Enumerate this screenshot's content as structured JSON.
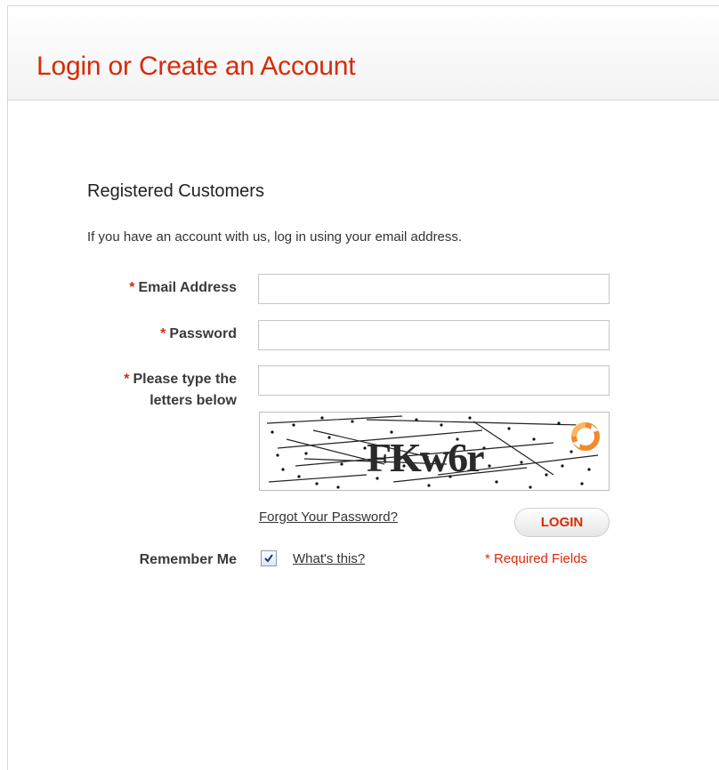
{
  "page": {
    "title": "Login or Create an Account"
  },
  "section": {
    "title": "Registered Customers",
    "intro": "If you have an account with us, log in using your email address."
  },
  "form": {
    "required_mark": "*",
    "email": {
      "label": "Email Address",
      "value": ""
    },
    "password": {
      "label": "Password",
      "value": ""
    },
    "captcha": {
      "label_line1": "Please type the",
      "label_line2": "letters below",
      "value": "",
      "image_text": "FKw6r",
      "refresh_icon": "refresh-icon"
    },
    "forgot_password_label": "Forgot Your Password?",
    "login_label": "LOGIN",
    "remember_me": {
      "label": "Remember Me",
      "checked": true,
      "help_link": "What's this?"
    },
    "required_fields_note": "* Required Fields"
  },
  "colors": {
    "accent": "#d62b0a",
    "text": "#333333",
    "border": "#c6c6c6"
  }
}
